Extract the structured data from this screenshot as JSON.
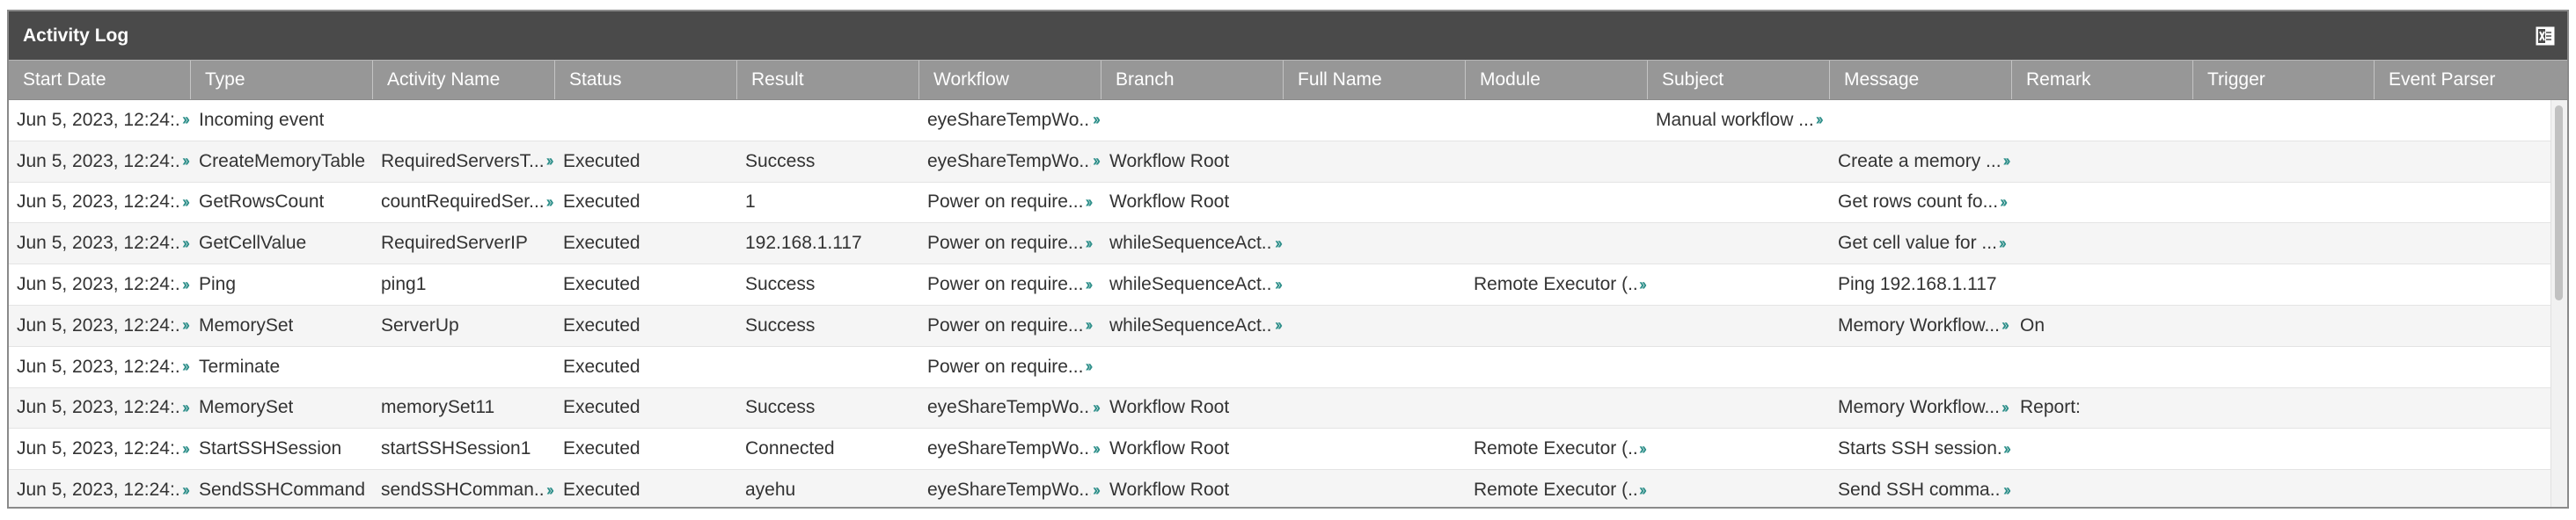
{
  "panel": {
    "title": "Activity Log",
    "export_icon": "excel-export-icon"
  },
  "columns": [
    {
      "key": "start_date",
      "label": "Start Date"
    },
    {
      "key": "type",
      "label": "Type"
    },
    {
      "key": "activity_name",
      "label": "Activity Name"
    },
    {
      "key": "status",
      "label": "Status"
    },
    {
      "key": "result",
      "label": "Result"
    },
    {
      "key": "workflow",
      "label": "Workflow"
    },
    {
      "key": "branch",
      "label": "Branch"
    },
    {
      "key": "full_name",
      "label": "Full Name"
    },
    {
      "key": "module",
      "label": "Module"
    },
    {
      "key": "subject",
      "label": "Subject"
    },
    {
      "key": "message",
      "label": "Message"
    },
    {
      "key": "remark",
      "label": "Remark"
    },
    {
      "key": "trigger",
      "label": "Trigger"
    },
    {
      "key": "event_parser",
      "label": "Event Parser"
    }
  ],
  "rows": [
    {
      "start_date": "Jun 5, 2023, 12:24:...",
      "type": "Incoming event",
      "activity_name": "",
      "status": "",
      "result": "",
      "workflow": "eyeShareTempWo...",
      "branch": "",
      "full_name": "",
      "module": "",
      "subject": "Manual workflow ...",
      "message": "",
      "remark": "",
      "trigger": "",
      "event_parser": ""
    },
    {
      "start_date": "Jun 5, 2023, 12:24:...",
      "type": "CreateMemoryTable",
      "activity_name": "RequiredServersT...",
      "status": "Executed",
      "result": "Success",
      "workflow": "eyeShareTempWo...",
      "branch": "Workflow Root",
      "full_name": "",
      "module": "",
      "subject": "",
      "message": "Create a memory ...",
      "remark": "",
      "trigger": "",
      "event_parser": ""
    },
    {
      "start_date": "Jun 5, 2023, 12:24:...",
      "type": "GetRowsCount",
      "activity_name": "countRequiredSer...",
      "status": "Executed",
      "result": "1",
      "workflow": "Power on require...",
      "branch": "Workflow Root",
      "full_name": "",
      "module": "",
      "subject": "",
      "message": "Get rows count fo...",
      "remark": "",
      "trigger": "",
      "event_parser": ""
    },
    {
      "start_date": "Jun 5, 2023, 12:24:...",
      "type": "GetCellValue",
      "activity_name": "RequiredServerIP",
      "status": "Executed",
      "result": "192.168.1.117",
      "workflow": "Power on require...",
      "branch": "whileSequenceAct...",
      "full_name": "",
      "module": "",
      "subject": "",
      "message": "Get cell value for ...",
      "remark": "",
      "trigger": "",
      "event_parser": ""
    },
    {
      "start_date": "Jun 5, 2023, 12:24:...",
      "type": "Ping",
      "activity_name": "ping1",
      "status": "Executed",
      "result": "Success",
      "workflow": "Power on require...",
      "branch": "whileSequenceAct...",
      "full_name": "",
      "module": "Remote Executor (...",
      "subject": "",
      "message": "Ping 192.168.1.117",
      "remark": "",
      "trigger": "",
      "event_parser": ""
    },
    {
      "start_date": "Jun 5, 2023, 12:24:...",
      "type": "MemorySet",
      "activity_name": "ServerUp",
      "status": "Executed",
      "result": "Success",
      "workflow": "Power on require...",
      "branch": "whileSequenceAct...",
      "full_name": "",
      "module": "",
      "subject": "",
      "message": "Memory Workflow...",
      "remark": "On",
      "trigger": "",
      "event_parser": ""
    },
    {
      "start_date": "Jun 5, 2023, 12:24:...",
      "type": "Terminate",
      "activity_name": "",
      "status": "Executed",
      "result": "",
      "workflow": "Power on require...",
      "branch": "",
      "full_name": "",
      "module": "",
      "subject": "",
      "message": "",
      "remark": "",
      "trigger": "",
      "event_parser": ""
    },
    {
      "start_date": "Jun 5, 2023, 12:24:...",
      "type": "MemorySet",
      "activity_name": "memorySet11",
      "status": "Executed",
      "result": "Success",
      "workflow": "eyeShareTempWo...",
      "branch": "Workflow Root",
      "full_name": "",
      "module": "",
      "subject": "",
      "message": "Memory Workflow...",
      "remark": "Report:",
      "trigger": "",
      "event_parser": ""
    },
    {
      "start_date": "Jun 5, 2023, 12:24:...",
      "type": "StartSSHSession",
      "activity_name": "startSSHSession1",
      "status": "Executed",
      "result": "Connected",
      "workflow": "eyeShareTempWo...",
      "branch": "Workflow Root",
      "full_name": "",
      "module": "Remote Executor (...",
      "subject": "",
      "message": "Starts SSH session...",
      "remark": "",
      "trigger": "",
      "event_parser": ""
    },
    {
      "start_date": "Jun 5, 2023, 12:24:...",
      "type": "SendSSHCommand",
      "activity_name": "sendSSHComman...",
      "status": "Executed",
      "result": "ayehu",
      "workflow": "eyeShareTempWo...",
      "branch": "Workflow Root",
      "full_name": "",
      "module": "Remote Executor (...",
      "subject": "",
      "message": "Send SSH comma...",
      "remark": "",
      "trigger": "",
      "event_parser": ""
    }
  ],
  "expandable": {
    "start_date": true,
    "activity_name_if": [
      "RequiredServersT...",
      "countRequiredSer...",
      "sendSSHComman..."
    ],
    "workflow": true,
    "branch_if_not": [
      "Workflow Root",
      ""
    ],
    "module": true,
    "subject": true,
    "message_if_not": [
      "Ping 192.168.1.117",
      ""
    ]
  },
  "colors": {
    "titlebar": "#4a4a4a",
    "header": "#979797",
    "expand_arrow": "#2e8f8a"
  }
}
